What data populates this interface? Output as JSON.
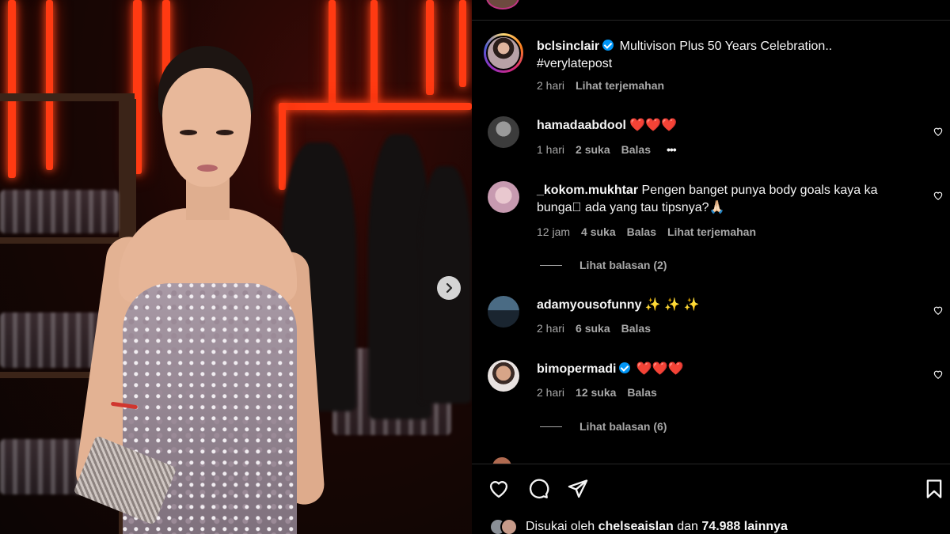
{
  "post": {
    "username": "bclsinclair",
    "caption_line1": "Multivison Plus 50 Years Celebration..",
    "caption_line2": "#verylatepost",
    "time": "2 hari",
    "translate": "Lihat terjemahan"
  },
  "comments": [
    {
      "username": "hamadaabdool",
      "text": "❤️❤️❤️",
      "time": "1 hari",
      "likes": "2 suka",
      "reply": "Balas",
      "more": "•••"
    },
    {
      "username": "_kokom.mukhtar",
      "text_line1": "Pengen banget punya body goals kaya ka",
      "text_line2": "bunga🏻 ada yang tau tipsnya?🙏🏻",
      "time": "12 jam",
      "likes": "4 suka",
      "reply": "Balas",
      "translate": "Lihat terjemahan",
      "view_replies": "Lihat balasan (2)"
    },
    {
      "username": "adamyousofunny",
      "text": "✨ ✨ ✨",
      "time": "2 hari",
      "likes": "6 suka",
      "reply": "Balas"
    },
    {
      "username": "bimopermadi",
      "text": "❤️❤️❤️",
      "time": "2 hari",
      "likes": "12 suka",
      "reply": "Balas",
      "view_replies": "Lihat balasan (6)"
    }
  ],
  "likes_bar": {
    "prefix": "Disukai oleh",
    "user": "chelseaislan",
    "middle": "dan",
    "count": "74.988",
    "suffix": "lainnya"
  },
  "icons": {
    "next": "chevron-right-icon",
    "like": "heart-icon",
    "comment": "comment-icon",
    "share": "send-icon",
    "save": "bookmark-icon",
    "verified": "verified-badge-icon"
  },
  "colors": {
    "background": "#000000",
    "text": "#f5f5f5",
    "muted": "#a8a8a8",
    "verified": "#0095f6",
    "neon": "#ff3a12"
  }
}
